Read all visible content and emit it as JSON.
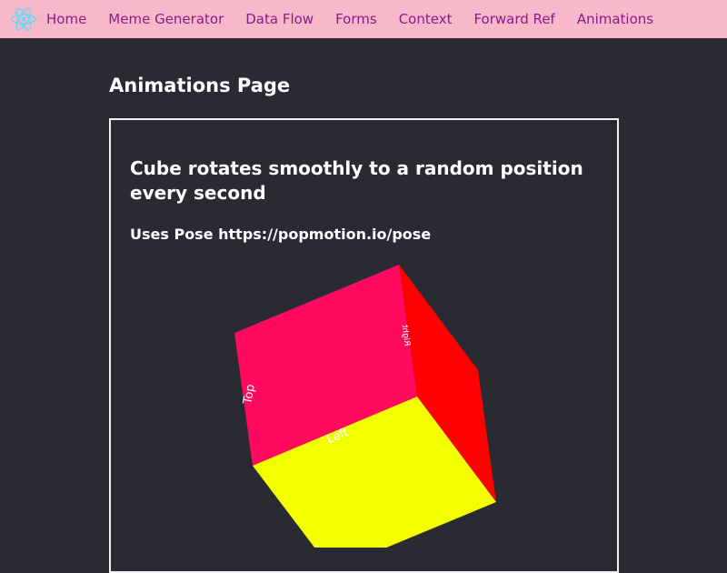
{
  "nav": {
    "logo_icon": "react-atom-icon",
    "links": [
      "Home",
      "Meme Generator",
      "Data Flow",
      "Forms",
      "Context",
      "Forward Ref",
      "Animations"
    ]
  },
  "page": {
    "title": "Animations Page"
  },
  "panel": {
    "heading": "Cube rotates smoothly to a random position every second",
    "subheading": "Uses Pose https://popmotion.io/pose"
  },
  "cube": {
    "faces": {
      "top": {
        "label": "Top",
        "color": "#ff0a5e"
      },
      "left": {
        "label": "Left",
        "color": "#f3ff00"
      },
      "right": {
        "label": "Right",
        "color": "#ff0000"
      }
    }
  },
  "colors": {
    "nav_bg": "#f7b8c9",
    "nav_link": "#8a1a8c",
    "page_bg": "#2a2a33",
    "logo": "#61dafb"
  }
}
